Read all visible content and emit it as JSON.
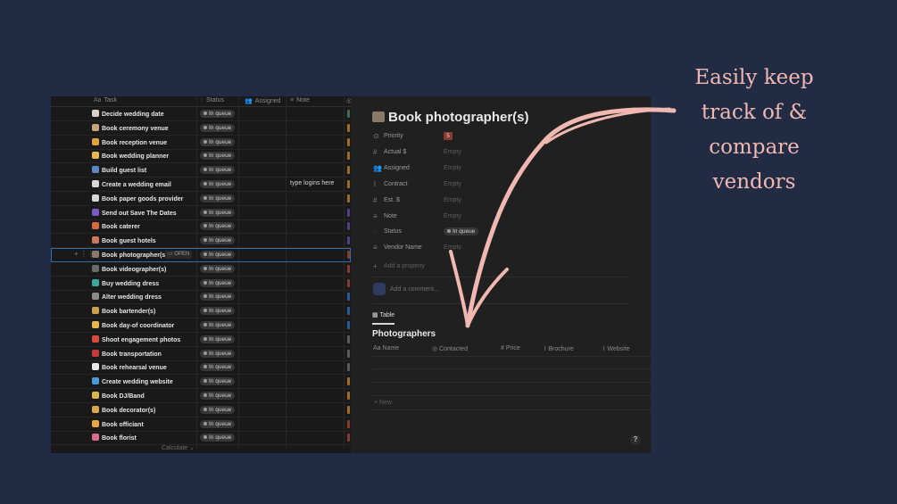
{
  "table": {
    "headers": {
      "task": "Task",
      "task_icon": "Aa",
      "status": "Status",
      "assigned": "Assigned",
      "note": "Note"
    },
    "open_label": "OPEN",
    "calculate": "Calculate",
    "rows": [
      {
        "task": "Decide wedding date",
        "status": "In queue",
        "note": "",
        "emoji_color": "#d9d2c4",
        "edge_color": "#3f6b52"
      },
      {
        "task": "Book ceremony venue",
        "status": "In queue",
        "note": "",
        "emoji_color": "#c8a27a",
        "edge_color": "#a06a2a"
      },
      {
        "task": "Book reception venue",
        "status": "In queue",
        "note": "",
        "emoji_color": "#e0a23a",
        "edge_color": "#a06a2a"
      },
      {
        "task": "Book wedding planner",
        "status": "In queue",
        "note": "",
        "emoji_color": "#e8b84a",
        "edge_color": "#a06a2a"
      },
      {
        "task": "Build guest list",
        "status": "In queue",
        "note": "",
        "emoji_color": "#5a86c8",
        "edge_color": "#a06a2a"
      },
      {
        "task": "Create a wedding email",
        "status": "In queue",
        "note": "type logins here",
        "emoji_color": "#d8d8d8",
        "edge_color": "#a06a2a"
      },
      {
        "task": "Book paper goods provider",
        "status": "In queue",
        "note": "",
        "emoji_color": "#d8d8d8",
        "edge_color": "#a06a2a"
      },
      {
        "task": "Send out Save The Dates",
        "status": "In queue",
        "note": "",
        "emoji_color": "#7a5ac8",
        "edge_color": "#5a3a8a"
      },
      {
        "task": "Book caterer",
        "status": "In queue",
        "note": "",
        "emoji_color": "#d86a3a",
        "edge_color": "#5a3a8a"
      },
      {
        "task": "Book guest hotels",
        "status": "In queue",
        "note": "",
        "emoji_color": "#c87a5a",
        "edge_color": "#5a3a8a"
      },
      {
        "task": "Book photographer(s)",
        "status": "In queue",
        "note": "",
        "emoji_color": "#8a7a6a",
        "edge_color": "#8a3a2a"
      },
      {
        "task": "Book videographer(s)",
        "status": "In queue",
        "note": "",
        "emoji_color": "#6a6a6a",
        "edge_color": "#8a3a2a"
      },
      {
        "task": "Buy wedding dress",
        "status": "In queue",
        "note": "",
        "emoji_color": "#3aa8a0",
        "edge_color": "#8a3a2a"
      },
      {
        "task": "Alter wedding dress",
        "status": "In queue",
        "note": "",
        "emoji_color": "#8a8a8a",
        "edge_color": "#2a5a9a"
      },
      {
        "task": "Book bartender(s)",
        "status": "In queue",
        "note": "",
        "emoji_color": "#c8a24a",
        "edge_color": "#2a5a9a"
      },
      {
        "task": "Book day-of coordinator",
        "status": "In queue",
        "note": "",
        "emoji_color": "#e8b84a",
        "edge_color": "#2a5a9a"
      },
      {
        "task": "Shoot engagement photos",
        "status": "In queue",
        "note": "",
        "emoji_color": "#d84a3a",
        "edge_color": "#5a5a5a"
      },
      {
        "task": "Book transportation",
        "status": "In queue",
        "note": "",
        "emoji_color": "#c83a3a",
        "edge_color": "#5a5a5a"
      },
      {
        "task": "Book rehearsal venue",
        "status": "In queue",
        "note": "",
        "emoji_color": "#e8e8e8",
        "edge_color": "#5a5a5a"
      },
      {
        "task": "Create wedding website",
        "status": "In queue",
        "note": "",
        "emoji_color": "#4a9ad8",
        "edge_color": "#a06a2a"
      },
      {
        "task": "Book DJ/Band",
        "status": "In queue",
        "note": "",
        "emoji_color": "#d8b84a",
        "edge_color": "#a06a2a"
      },
      {
        "task": "Book decorator(s)",
        "status": "In queue",
        "note": "",
        "emoji_color": "#d8a84a",
        "edge_color": "#a06a2a"
      },
      {
        "task": "Book officiant",
        "status": "In queue",
        "note": "",
        "emoji_color": "#e8a83a",
        "edge_color": "#8a3a2a"
      },
      {
        "task": "Book florist",
        "status": "In queue",
        "note": "",
        "emoji_color": "#d86a8a",
        "edge_color": "#8a3a2a"
      }
    ]
  },
  "page": {
    "title": "Book photographer(s)",
    "props": [
      {
        "label": "Priority",
        "value": "5",
        "icon": "priority-icon",
        "glyph": "⊙",
        "kind": "priority"
      },
      {
        "label": "Actual $",
        "value": "Empty",
        "icon": "number-icon",
        "glyph": "#",
        "kind": "empty"
      },
      {
        "label": "Assigned",
        "value": "Empty",
        "icon": "people-icon",
        "glyph": "👥",
        "kind": "empty"
      },
      {
        "label": "Contract",
        "value": "Empty",
        "icon": "attachment-icon",
        "glyph": "⌇",
        "kind": "empty"
      },
      {
        "label": "Est. $",
        "value": "Empty",
        "icon": "number-icon",
        "glyph": "#",
        "kind": "empty"
      },
      {
        "label": "Note",
        "value": "Empty",
        "icon": "text-icon",
        "glyph": "≡",
        "kind": "empty"
      },
      {
        "label": "Status",
        "value": "In queue",
        "icon": "status-icon",
        "glyph": "◌",
        "kind": "status"
      },
      {
        "label": "Vendor Name",
        "value": "Empty",
        "icon": "text-icon",
        "glyph": "≡",
        "kind": "empty"
      }
    ],
    "add_property": "Add a property",
    "comment_placeholder": "Add a comment...",
    "tab_label": "Table",
    "db_title": "Photographers",
    "db_headers": [
      {
        "icon": "Aa",
        "label": "Name"
      },
      {
        "icon": "◎",
        "label": "Contacted"
      },
      {
        "icon": "#",
        "label": "Price"
      },
      {
        "icon": "⌇",
        "label": "Brochure"
      },
      {
        "icon": "⌇",
        "label": "Website"
      }
    ],
    "new_label": "New",
    "help": "?"
  },
  "tagline": "Easily keep track of & compare vendors",
  "colors": {
    "background": "#222b44",
    "accent": "#f0b8b0",
    "priority": "#8a3b2f"
  }
}
